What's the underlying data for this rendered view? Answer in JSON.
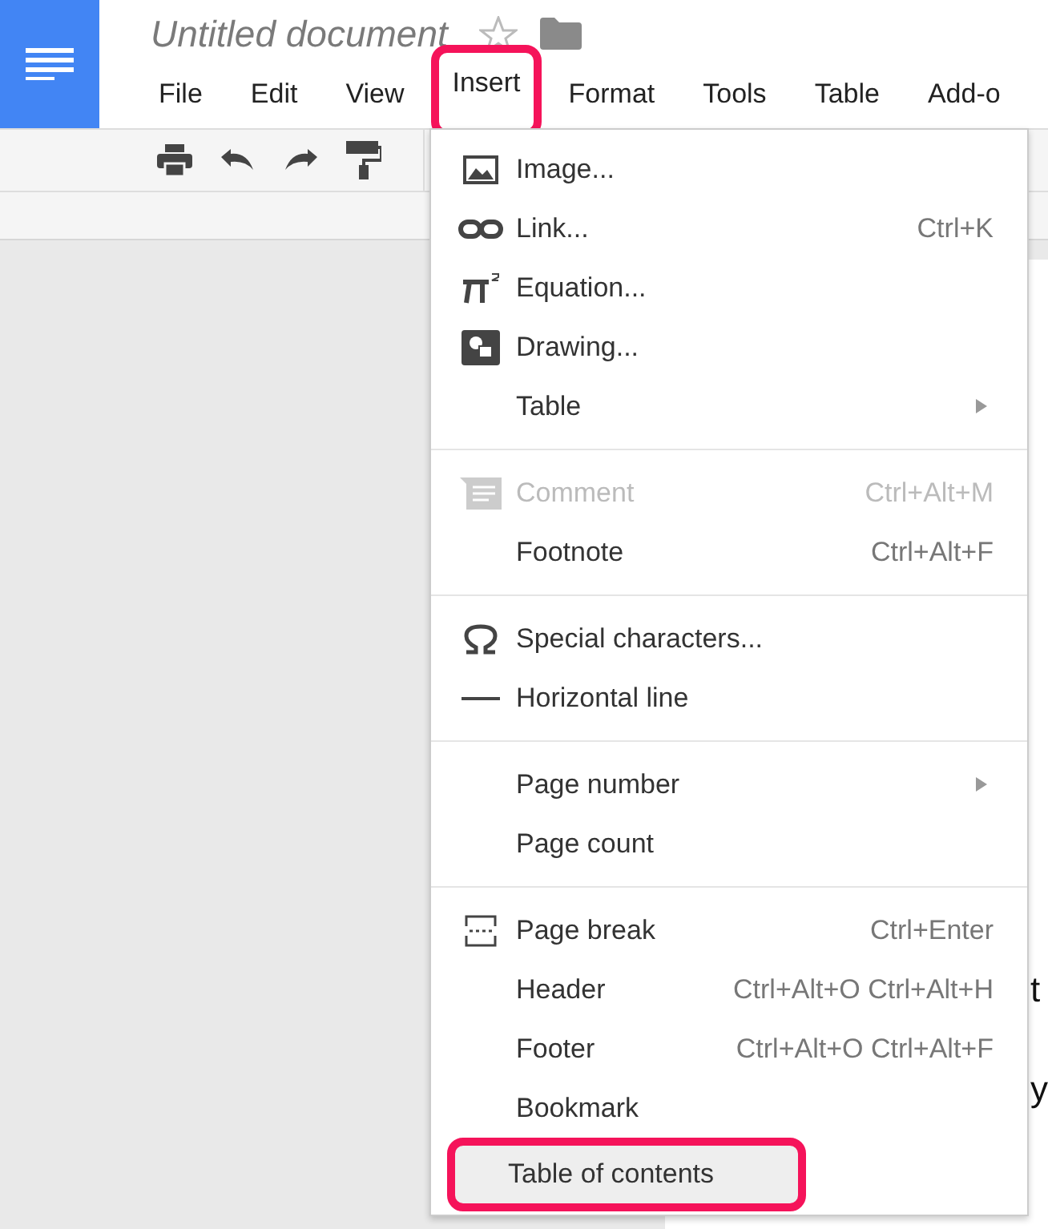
{
  "document_title": "Untitled document",
  "menu_bar": [
    {
      "label": "File",
      "annotated": false
    },
    {
      "label": "Edit",
      "annotated": false
    },
    {
      "label": "View",
      "annotated": false
    },
    {
      "label": "Insert",
      "annotated": true
    },
    {
      "label": "Format",
      "annotated": false
    },
    {
      "label": "Tools",
      "annotated": false
    },
    {
      "label": "Table",
      "annotated": false
    },
    {
      "label": "Add-o",
      "annotated": false
    }
  ],
  "insert_menu": [
    [
      {
        "label": "Image...",
        "disabled": false,
        "selected": false,
        "submenu": false
      },
      {
        "label": "Link...",
        "shortcut": "Ctrl+K",
        "disabled": false,
        "selected": false,
        "submenu": false
      },
      {
        "label": "Equation...",
        "disabled": false,
        "selected": false,
        "submenu": false
      },
      {
        "label": "Drawing...",
        "disabled": false,
        "selected": false,
        "submenu": false
      },
      {
        "label": "Table",
        "disabled": false,
        "selected": false,
        "submenu": true
      }
    ],
    [
      {
        "label": "Comment",
        "shortcut": "Ctrl+Alt+M",
        "disabled": true,
        "selected": false,
        "submenu": false
      },
      {
        "label": "Footnote",
        "shortcut": "Ctrl+Alt+F",
        "disabled": false,
        "selected": false,
        "submenu": false
      }
    ],
    [
      {
        "label": "Special characters...",
        "disabled": false,
        "selected": false,
        "submenu": false
      },
      {
        "label": "Horizontal line",
        "disabled": false,
        "selected": false,
        "submenu": false
      }
    ],
    [
      {
        "label": "Page number",
        "disabled": false,
        "selected": false,
        "submenu": true
      },
      {
        "label": "Page count",
        "disabled": false,
        "selected": false,
        "submenu": false
      }
    ],
    [
      {
        "label": "Page break",
        "shortcut": "Ctrl+Enter",
        "disabled": false,
        "selected": false,
        "submenu": false
      },
      {
        "label": "Header",
        "shortcut": "Ctrl+Alt+O Ctrl+Alt+H",
        "disabled": false,
        "selected": false,
        "submenu": false
      },
      {
        "label": "Footer",
        "shortcut": "Ctrl+Alt+O Ctrl+Alt+F",
        "disabled": false,
        "selected": false,
        "submenu": false
      },
      {
        "label": "Bookmark",
        "disabled": false,
        "selected": false,
        "submenu": false
      },
      {
        "label": "Table of contents",
        "disabled": false,
        "selected": true,
        "submenu": false,
        "annotated": true
      }
    ]
  ],
  "document_fragments": [
    {
      "kind": "line",
      "text": "t"
    },
    {
      "kind": "line",
      "text": "y"
    }
  ]
}
